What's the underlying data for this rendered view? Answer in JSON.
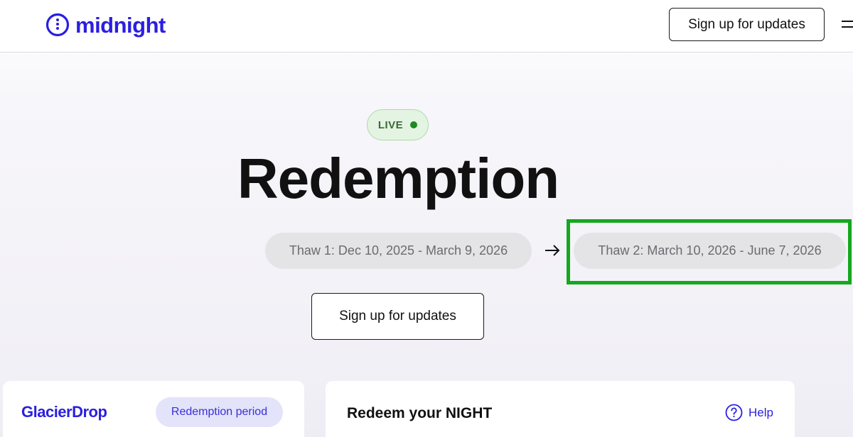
{
  "header": {
    "logo_text": "midnight",
    "signup_label": "Sign up for updates",
    "menu_icon": "hamburger-menu-icon"
  },
  "hero": {
    "status_badge": "LIVE",
    "title": "Redemption",
    "thaw_periods": [
      {
        "label": "Thaw 1: Dec 10, 2025 - March 9, 2026"
      },
      {
        "label": "Thaw 2: March 10, 2026 - June 7, 2026"
      }
    ],
    "signup_label": "Sign up for updates"
  },
  "cards": {
    "glacier": {
      "logo_text": "GlacierDrop",
      "badge": "Redemption period"
    },
    "redeem": {
      "title": "Redeem your NIGHT",
      "help_label": "Help"
    }
  },
  "colors": {
    "brand": "#2a1fe0",
    "live_green": "#1e8a22",
    "highlight": "#14a81e"
  }
}
